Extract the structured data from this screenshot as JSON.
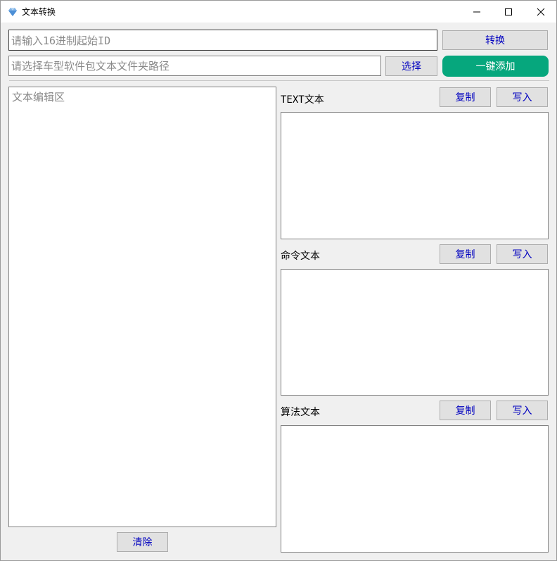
{
  "window": {
    "title": "文本转换"
  },
  "top": {
    "hex_input_placeholder": "请输入16进制起始ID",
    "convert_label": "转换",
    "path_input_placeholder": "请选择车型软件包文本文件夹路径",
    "select_label": "选择",
    "one_click_add_label": "一键添加"
  },
  "editor": {
    "placeholder": "文本编辑区",
    "clear_label": "清除"
  },
  "sections": [
    {
      "label": "TEXT文本",
      "copy_label": "复制",
      "write_label": "写入"
    },
    {
      "label": "命令文本",
      "copy_label": "复制",
      "write_label": "写入"
    },
    {
      "label": "算法文本",
      "copy_label": "复制",
      "write_label": "写入"
    }
  ],
  "colors": {
    "accent_green": "#06a77d",
    "button_text": "#0000c0",
    "window_bg": "#f0f0f0"
  }
}
